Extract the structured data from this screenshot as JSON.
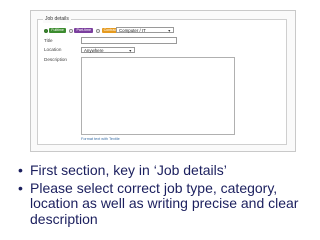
{
  "form": {
    "legend": "Job details",
    "job_types": [
      {
        "label": "Fulltime",
        "color": "#3c8c2f"
      },
      {
        "label": "Part-time",
        "color": "#7b3f9e"
      },
      {
        "label": "Contract",
        "color": "#e59a1f"
      }
    ],
    "category_value": "Computer / IT",
    "title_label": "Title",
    "title_value": "",
    "location_label": "Location",
    "location_value": "Anywhere",
    "description_label": "Description",
    "format_hint": "Format text with Textile"
  },
  "notes": [
    "First section, key in ‘Job details’",
    "Please select correct job type, category, location as well as writing precise and clear description"
  ],
  "bullet_glyph": "•"
}
